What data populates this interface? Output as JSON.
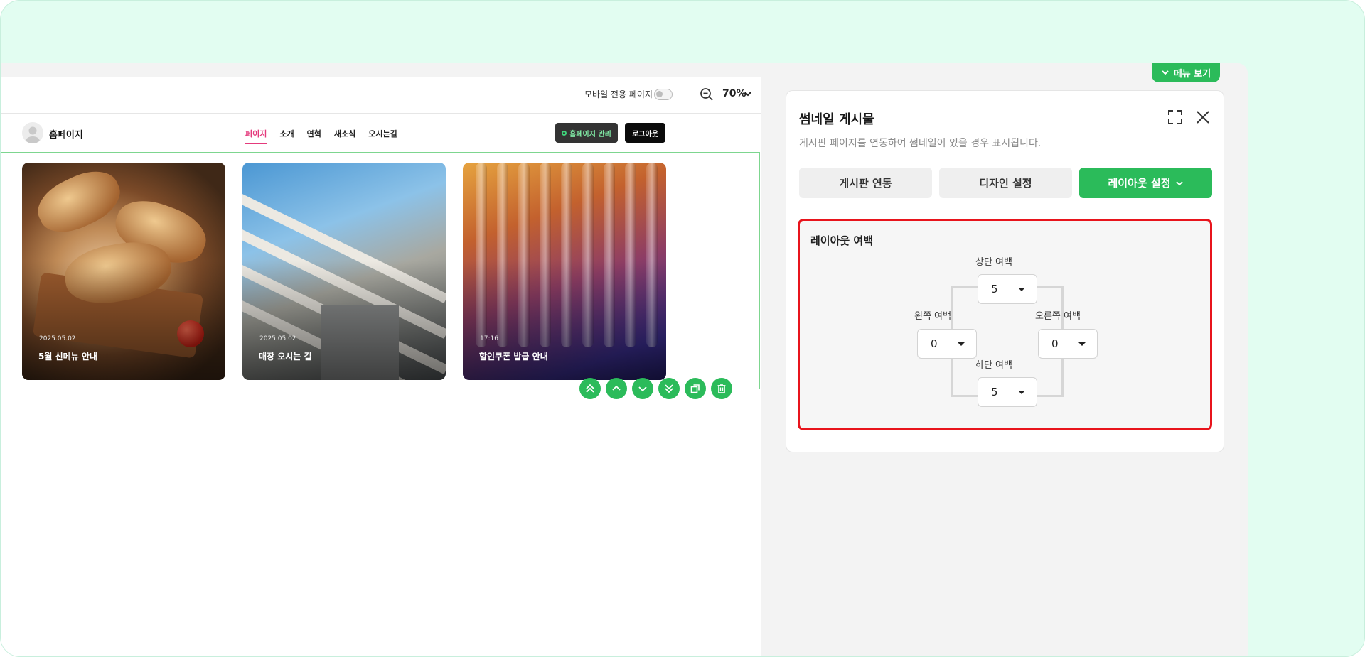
{
  "canvas": {
    "mobile_only_label": "모바일 전용 페이지",
    "zoom_value": "70%"
  },
  "site": {
    "name": "홈페이지",
    "nav": [
      {
        "label": "페이지",
        "active": true
      },
      {
        "label": "소개",
        "active": false
      },
      {
        "label": "연혁",
        "active": false
      },
      {
        "label": "새소식",
        "active": false
      },
      {
        "label": "오시는길",
        "active": false
      }
    ],
    "manage_label": "홈페이지 관리",
    "logout_label": "로그아웃"
  },
  "cards": [
    {
      "date": "2025.05.02",
      "title": "5월 신메뉴 안내"
    },
    {
      "date": "2025.05.02",
      "title": "매장 오시는 길"
    },
    {
      "date": "17:16",
      "title": "할인쿠폰 발급 안내"
    }
  ],
  "toolbar": {
    "icons": [
      "move-top-icon",
      "move-up-icon",
      "move-down-icon",
      "move-bottom-icon",
      "copy-icon",
      "delete-icon"
    ]
  },
  "menu_tab": {
    "label": "메뉴 보기"
  },
  "panel": {
    "title": "썸네일 게시물",
    "description": "게시판 페이지를 연동하여 썸네일이 있을 경우 표시됩니다.",
    "tabs": [
      {
        "label": "게시판 연동",
        "active": false
      },
      {
        "label": "디자인 설정",
        "active": false
      },
      {
        "label": "레이아웃 설정",
        "active": true
      }
    ],
    "layout_margin": {
      "heading": "레이아웃 여백",
      "top": {
        "label": "상단 여백",
        "value": "5"
      },
      "left": {
        "label": "왼쪽 여백",
        "value": "0"
      },
      "right": {
        "label": "오른쪽 여백",
        "value": "0"
      },
      "bottom": {
        "label": "하단 여백",
        "value": "5"
      }
    }
  },
  "colors": {
    "accent": "#2bbb5a",
    "highlight": "#e8141c",
    "nav_active": "#e43a7c"
  }
}
